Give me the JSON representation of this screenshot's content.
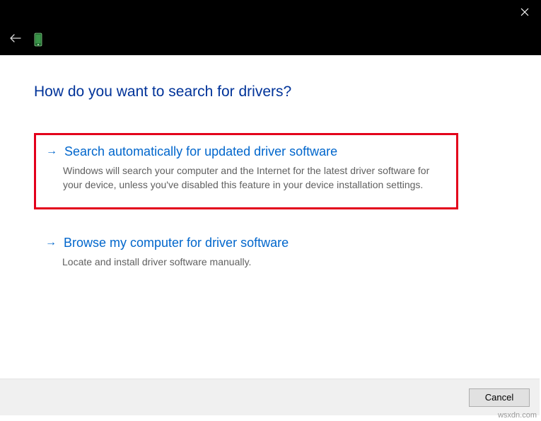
{
  "page_title": "How do you want to search for drivers?",
  "options": [
    {
      "title": "Search automatically for updated driver software",
      "description": "Windows will search your computer and the Internet for the latest driver software for your device, unless you've disabled this feature in your device installation settings.",
      "highlighted": true
    },
    {
      "title": "Browse my computer for driver software",
      "description": "Locate and install driver software manually.",
      "highlighted": false
    }
  ],
  "footer": {
    "cancel_label": "Cancel"
  },
  "watermark": "wsxdn.com"
}
